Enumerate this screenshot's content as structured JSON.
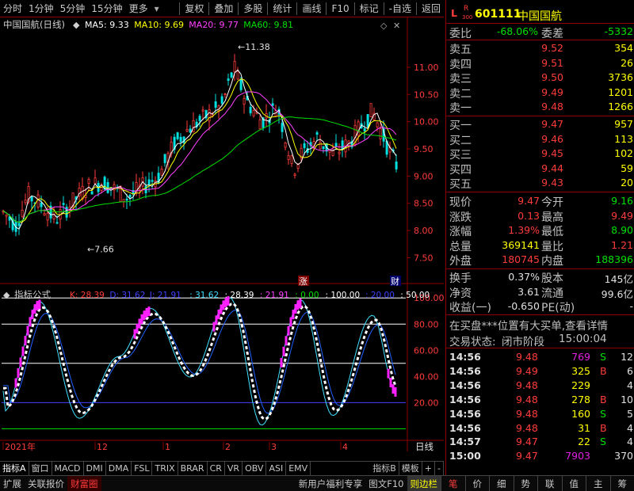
{
  "toolbar": {
    "left": [
      "分时",
      "1分钟",
      "5分钟",
      "15分钟",
      "更多"
    ],
    "right": [
      "复权",
      "叠加",
      "多股",
      "统计",
      "画线",
      "F10",
      "标记",
      "-自选",
      "返回"
    ]
  },
  "quote": {
    "code": "601111",
    "name": "中国国航",
    "mark_l": "L",
    "mark_r": "R",
    "mark_r_sub": "300",
    "weibi_label": "委比",
    "weibi": "-68.06%",
    "weicha_label": "委差",
    "weicha": "-5332",
    "sells": [
      {
        "label": "卖五",
        "price": "9.52",
        "vol": "354"
      },
      {
        "label": "卖四",
        "price": "9.51",
        "vol": "26"
      },
      {
        "label": "卖三",
        "price": "9.50",
        "vol": "3736"
      },
      {
        "label": "卖二",
        "price": "9.49",
        "vol": "1201"
      },
      {
        "label": "卖一",
        "price": "9.48",
        "vol": "1266"
      }
    ],
    "buys": [
      {
        "label": "买一",
        "price": "9.47",
        "vol": "957"
      },
      {
        "label": "买二",
        "price": "9.46",
        "vol": "113"
      },
      {
        "label": "买三",
        "price": "9.45",
        "vol": "102"
      },
      {
        "label": "买四",
        "price": "9.44",
        "vol": "59"
      },
      {
        "label": "买五",
        "price": "9.43",
        "vol": "20"
      }
    ],
    "stats": [
      {
        "l1": "现价",
        "v1": "9.47",
        "c1": "red",
        "l2": "今开",
        "v2": "9.16",
        "c2": "grn"
      },
      {
        "l1": "涨跌",
        "v1": "0.13",
        "c1": "red",
        "l2": "最高",
        "v2": "9.49",
        "c2": "red"
      },
      {
        "l1": "涨幅",
        "v1": "1.39%",
        "c1": "red",
        "l2": "最低",
        "v2": "8.90",
        "c2": "grn"
      },
      {
        "l1": "总量",
        "v1": "369141",
        "c1": "yel",
        "l2": "量比",
        "v2": "1.21",
        "c2": "red"
      },
      {
        "l1": "外盘",
        "v1": "180745",
        "c1": "red",
        "l2": "内盘",
        "v2": "188396",
        "c2": "grn"
      }
    ],
    "stats2": [
      {
        "l1": "换手",
        "v1": "0.37%",
        "l2": "股本",
        "v2": "145亿"
      },
      {
        "l1": "净资",
        "v1": "3.61",
        "l2": "流通",
        "v2": "99.6亿"
      },
      {
        "l1": "收益(一)",
        "v1": "-0.650",
        "l2": "PE(动)",
        "v2": "-"
      }
    ],
    "notice": "在买盘***位置有大买单,查看详情",
    "trade_status_label": "交易状态:",
    "trade_status": "闭市阶段",
    "trade_time": "15:00:04",
    "ticks": [
      {
        "t": "14:56",
        "p": "9.48",
        "v": "769",
        "bs": "S",
        "n": "12",
        "vc": "mag",
        "bc": "grn"
      },
      {
        "t": "14:56",
        "p": "9.49",
        "v": "325",
        "bs": "B",
        "n": "6",
        "vc": "yel",
        "bc": "red"
      },
      {
        "t": "14:56",
        "p": "9.48",
        "v": "229",
        "bs": "",
        "n": "4",
        "vc": "yel",
        "bc": "wht"
      },
      {
        "t": "14:56",
        "p": "9.48",
        "v": "278",
        "bs": "B",
        "n": "10",
        "vc": "yel",
        "bc": "red"
      },
      {
        "t": "14:56",
        "p": "9.48",
        "v": "160",
        "bs": "S",
        "n": "5",
        "vc": "yel",
        "bc": "grn"
      },
      {
        "t": "14:56",
        "p": "9.48",
        "v": "31",
        "bs": "B",
        "n": "4",
        "vc": "yel",
        "bc": "red"
      },
      {
        "t": "14:57",
        "p": "9.47",
        "v": "22",
        "bs": "S",
        "n": "4",
        "vc": "yel",
        "bc": "grn"
      },
      {
        "t": "15:00",
        "p": "9.47",
        "v": "7903",
        "bs": "",
        "n": "370",
        "vc": "mag",
        "bc": "wht"
      }
    ]
  },
  "tabs1": [
    "指标A",
    "窗口",
    "MACD",
    "DMI",
    "DMA",
    "FSL",
    "TRIX",
    "BRAR",
    "CR",
    "VR",
    "OBV",
    "ASI",
    "EMV"
  ],
  "tabs1_right": [
    "指标B",
    "模板",
    "+",
    "-"
  ],
  "tabs2_left": [
    "扩展",
    "关联报价",
    "财富圈"
  ],
  "tabs2_mid": [
    "新用户福利专享",
    "图文F10",
    "则边栏"
  ],
  "tabs2_right": [
    "笔",
    "价",
    "细",
    "势",
    "联",
    "值",
    "主",
    "筹"
  ],
  "colors": {
    "up": "#ff3c3c",
    "down": "#00e0e0",
    "ma5": "#ffffff",
    "ma10": "#ffff00",
    "ma20": "#ff40ff",
    "ma60": "#00e000"
  },
  "chart_data": {
    "type": "candlestick",
    "title": "中国国航(日线)",
    "ma_legend": [
      {
        "name": "MA5",
        "value": "9.33"
      },
      {
        "name": "MA10",
        "value": "9.69"
      },
      {
        "name": "MA20",
        "value": "9.77"
      },
      {
        "name": "MA60",
        "value": "9.81"
      }
    ],
    "y_ticks": [
      "11.00",
      "10.50",
      "10.00",
      "9.50",
      "9.00",
      "8.50",
      "8.00",
      "7.50"
    ],
    "ylim": [
      7.2,
      11.8
    ],
    "annotations": {
      "high": "11.38",
      "low": "7.66",
      "zhang": "涨",
      "cai": "财"
    },
    "x_labels": [
      "2021年",
      "12",
      "1",
      "2",
      "3",
      "4"
    ],
    "period_label": "日线",
    "indicator": {
      "name": "指标公式",
      "legend": [
        {
          "name": "K",
          "value": "28.39",
          "color": "#ff3c3c"
        },
        {
          "name": "D",
          "value": "31.62",
          "color": "#4040ff"
        },
        {
          "name": "J",
          "value": "21.91",
          "color": "#4040ff"
        },
        {
          "name": "",
          "value": "31.62",
          "color": "#40e0ff"
        },
        {
          "name": "",
          "value": "28.39",
          "color": "#ffffff"
        },
        {
          "name": "",
          "value": "21.91",
          "color": "#ff40ff"
        },
        {
          "name": "",
          "value": "0.00",
          "color": "#00e000"
        },
        {
          "name": "",
          "value": "100.00",
          "color": "#ffffff"
        },
        {
          "name": "",
          "value": "20.00",
          "color": "#4040ff"
        },
        {
          "name": "",
          "value": "50.00",
          "color": "#ffffff"
        }
      ],
      "y_ticks": [
        "100.00",
        "80.00",
        "60.00",
        "40.00",
        "20.00"
      ],
      "ylim": [
        -4,
        108
      ]
    }
  }
}
